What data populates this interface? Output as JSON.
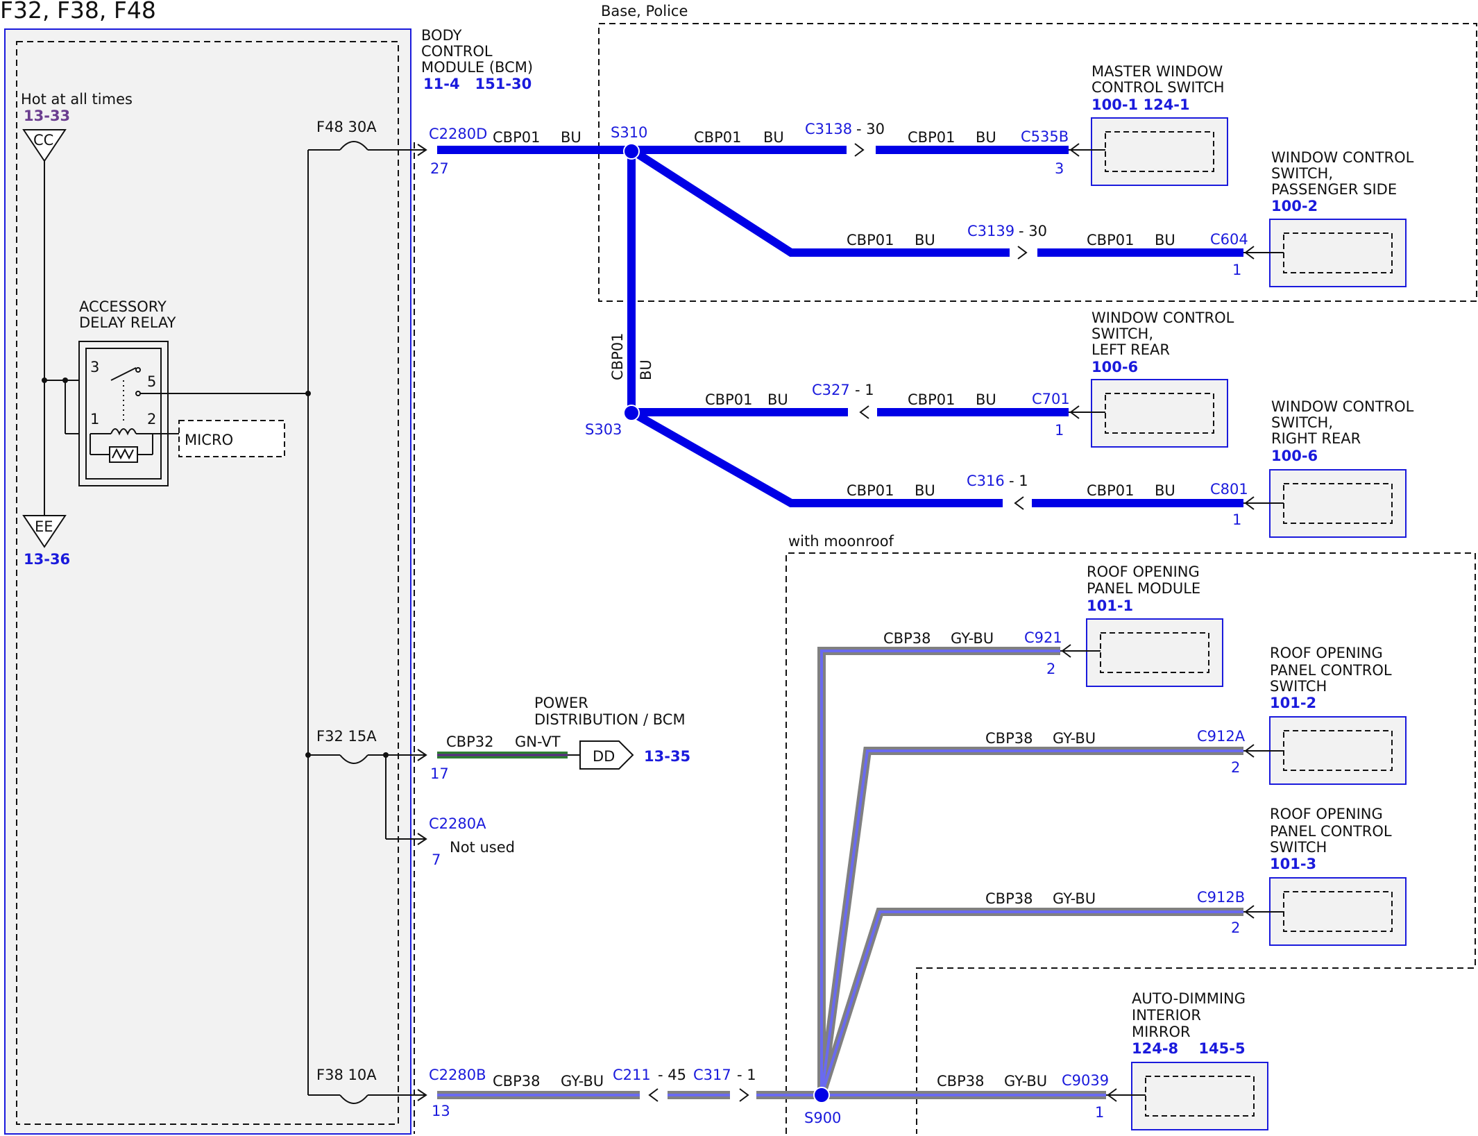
{
  "diagram": {
    "title": "F32, F38, F48",
    "colors": {
      "wire_bu": "#0000e6",
      "wire_gybu_outer": "#808080",
      "wire_gybu_inner": "#6a6af0",
      "wire_gnvt_outer": "#2e7d32",
      "wire_gnvt_inner": "#5c2a86",
      "ref_blue": "#1a1adc",
      "ref_purple": "#6a3d8f",
      "module_fill": "#f2f2f2",
      "module_border": "#1a1adc"
    },
    "fuse_box": {
      "hot_label": "Hot at all times",
      "hot_ref": "13-33",
      "cc_label": "CC",
      "ee_label": "EE",
      "ee_ref": "13-36",
      "relay_title_1": "ACCESSORY",
      "relay_title_2": "DELAY RELAY",
      "relay_pin_3": "3",
      "relay_pin_5": "5",
      "relay_pin_1": "1",
      "relay_pin_2": "2",
      "micro_label": "MICRO",
      "fuse_f48": "F48  30A",
      "fuse_f32": "F32  15A",
      "fuse_f38": "F38  10A"
    },
    "bcm": {
      "line1": "BODY",
      "line2": "CONTROL",
      "line3": "MODULE (BCM)",
      "ref": "11-4   151-30",
      "conn_d": "C2280D",
      "pin_d": "27",
      "conn_a": "C2280A",
      "pin_a": "7",
      "not_used": "Not used",
      "pin_a17": "17",
      "conn_b": "C2280B",
      "pin_b": "13"
    },
    "regions": {
      "base_police": "Base, Police",
      "with_moonroof": "with moonroof"
    },
    "wires": {
      "cbp01": "CBP01",
      "bu": "BU",
      "cbp38": "CBP38",
      "gybu": "GY-BU",
      "cbp32": "CBP32",
      "gnvt": "GN-VT"
    },
    "splices": {
      "s310": "S310",
      "s303": "S303",
      "s900": "S900"
    },
    "inline_connectors": {
      "c3138": "C3138",
      "c3138_pin": "- 30",
      "c3139": "C3139",
      "c3139_pin": "- 30",
      "c327": "C327",
      "c327_pin": "- 1",
      "c316": "C316",
      "c316_pin": "- 1",
      "c211": "C211",
      "c211_pin": "- 45",
      "c317": "C317",
      "c317_pin": "- 1"
    },
    "power_dist": {
      "line1": "POWER",
      "line2": "DISTRIBUTION / BCM",
      "dd": "DD",
      "ref": "13-35"
    },
    "modules": {
      "master": {
        "line1": "MASTER WINDOW",
        "line2": "CONTROL SWITCH",
        "ref": "100-1 124-1",
        "conn": "C535B",
        "pin": "3"
      },
      "pass": {
        "line1": "WINDOW CONTROL",
        "line2": "SWITCH,",
        "line3": "PASSENGER SIDE",
        "ref": "100-2",
        "conn": "C604",
        "pin": "1"
      },
      "lr": {
        "line1": "WINDOW CONTROL",
        "line2": "SWITCH,",
        "line3": "LEFT REAR",
        "ref": "100-6",
        "conn": "C701",
        "pin": "1"
      },
      "rr": {
        "line1": "WINDOW CONTROL",
        "line2": "SWITCH,",
        "line3": "RIGHT REAR",
        "ref": "100-6",
        "conn": "C801",
        "pin": "1"
      },
      "ropm": {
        "line1": "ROOF OPENING",
        "line2": "PANEL MODULE",
        "ref": "101-1",
        "conn": "C921",
        "pin": "2"
      },
      "ropcs1": {
        "line1": "ROOF OPENING",
        "line2": "PANEL CONTROL",
        "line3": "SWITCH",
        "ref": "101-2",
        "conn": "C912A",
        "pin": "2"
      },
      "ropcs2": {
        "line1": "ROOF OPENING",
        "line2": "PANEL CONTROL",
        "line3": "SWITCH",
        "ref": "101-3",
        "conn": "C912B",
        "pin": "2"
      },
      "mirror": {
        "line1": "AUTO-DIMMING",
        "line2": "INTERIOR",
        "line3": "MIRROR",
        "ref": "124-8    145-5",
        "conn": "C9039",
        "pin": "1"
      }
    }
  }
}
